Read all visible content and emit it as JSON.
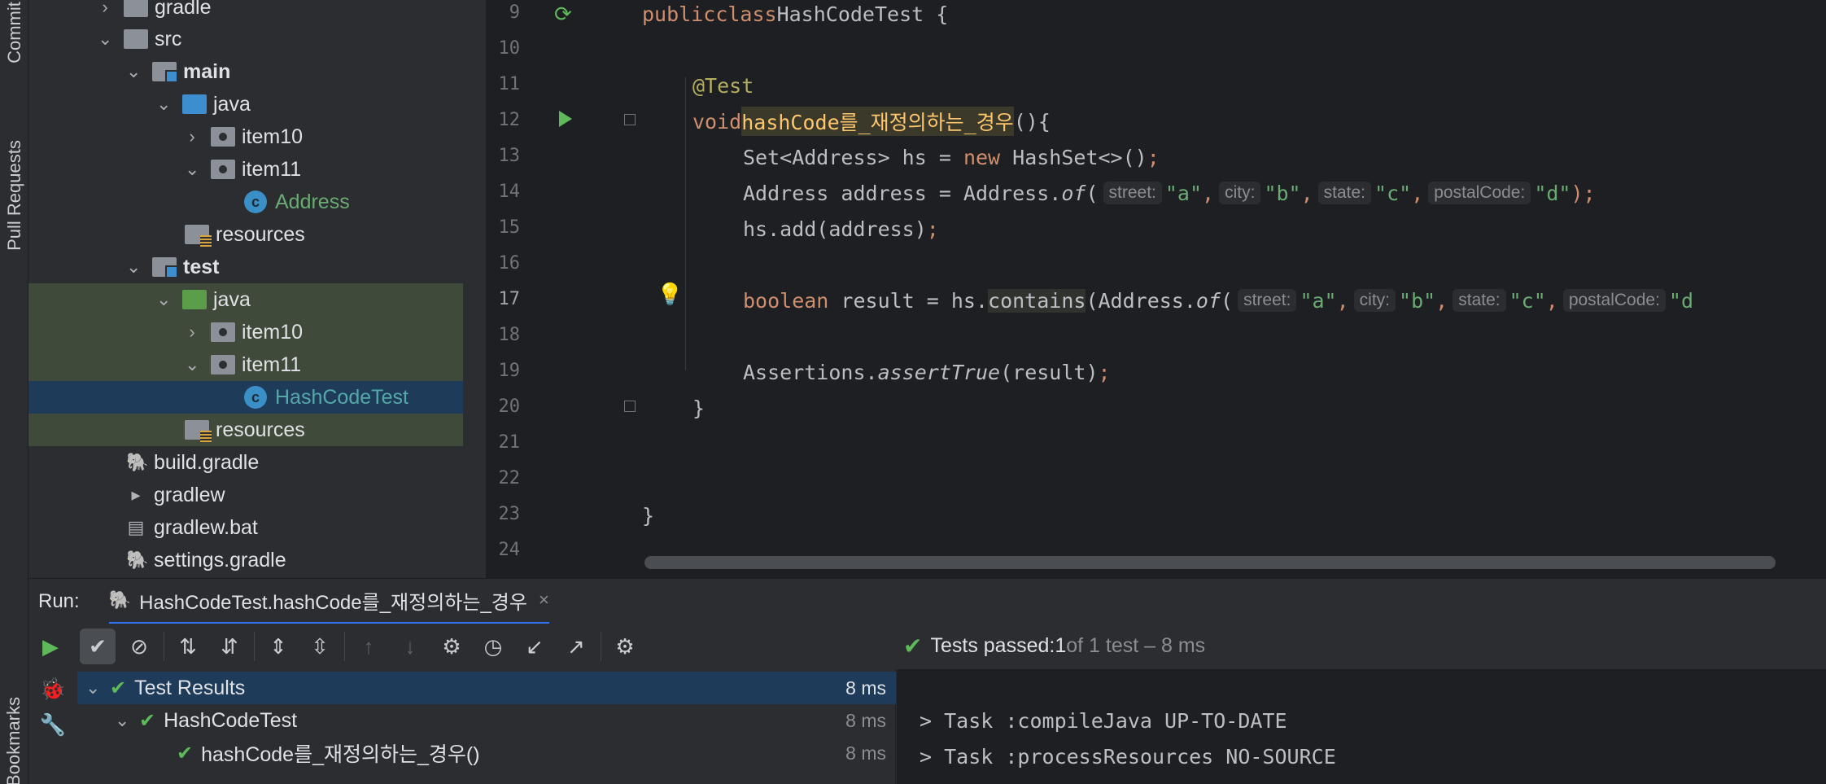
{
  "left_strip": {
    "tabs": [
      {
        "label": "Commit",
        "icon": "commit-icon"
      },
      {
        "label": "Pull Requests",
        "icon": "pull-requests-icon"
      },
      {
        "label": "Bookmarks",
        "icon": "bookmark-icon"
      }
    ]
  },
  "project_tree": {
    "items": [
      {
        "label": "gradle"
      },
      {
        "label": "src"
      },
      {
        "label": "main"
      },
      {
        "label": "java"
      },
      {
        "label": "item10"
      },
      {
        "label": "item11"
      },
      {
        "label": "Address"
      },
      {
        "label": "resources"
      },
      {
        "label": "test"
      },
      {
        "label": "java"
      },
      {
        "label": "item10"
      },
      {
        "label": "item11"
      },
      {
        "label": "HashCodeTest"
      },
      {
        "label": "resources"
      },
      {
        "label": "build.gradle"
      },
      {
        "label": "gradlew"
      },
      {
        "label": "gradlew.bat"
      },
      {
        "label": "settings.gradle"
      }
    ]
  },
  "editor": {
    "line_numbers": [
      "9",
      "10",
      "11",
      "12",
      "13",
      "14",
      "15",
      "16",
      "17",
      "18",
      "19",
      "20",
      "21",
      "22",
      "23",
      "24"
    ],
    "code": {
      "l9_kw1": "public",
      "l9_kw2": "class",
      "l9_rest": "HashCodeTest {",
      "l11_ann": "@Test",
      "l12_kw": "void",
      "l12_fn": "hashCode를_재정의하는_경우",
      "l12_rest": "(){",
      "l13_a": "Set<Address> hs = ",
      "l13_kw": "new",
      "l13_b": " HashSet<>()",
      "l13_semi": ";",
      "l14_a": "Address address = Address.",
      "l14_of": "of",
      "l14_paren": "(",
      "hint_street": "street:",
      "hint_city": "city:",
      "hint_state": "state:",
      "hint_postal": "postalCode:",
      "v_a": "\"a\"",
      "v_b": "\"b\"",
      "v_c": "\"c\"",
      "v_d": "\"d\"",
      "comma": ",",
      "l14_end": ");",
      "l15_a": "hs.add(address)",
      "l15_semi": ";",
      "l17_kw": "boolean",
      "l17_a": " result = hs.",
      "l17_contains": "contains",
      "l17_b": "(Address.",
      "l17_d_trunc": "\"d",
      "l19_a": "Assertions.",
      "l19_fn": "assertTrue",
      "l19_b": "(result)",
      "l19_semi": ";",
      "l20": "}",
      "l23": "}"
    }
  },
  "run_panel": {
    "label": "Run:",
    "tab_title": "HashCodeTest.hashCode를_재정의하는_경우",
    "close": "×",
    "status": {
      "prefix": "Tests passed: ",
      "count": "1",
      "suffix": " of 1 test – 8 ms"
    },
    "results": [
      {
        "label": "Test Results",
        "duration": "8 ms"
      },
      {
        "label": "HashCodeTest",
        "duration": "8 ms"
      },
      {
        "label": "hashCode를_재정의하는_경우()",
        "duration": "8 ms"
      }
    ],
    "console": [
      "> Task :compileJava UP-TO-DATE",
      "> Task :processResources NO-SOURCE"
    ]
  },
  "colors": {
    "editor_bg": "#1e1f22",
    "panel_bg": "#2b2d30",
    "selection": "#1e3c5a",
    "success": "#5fb85a",
    "keyword": "#cf8e6d",
    "string": "#6aab73"
  }
}
